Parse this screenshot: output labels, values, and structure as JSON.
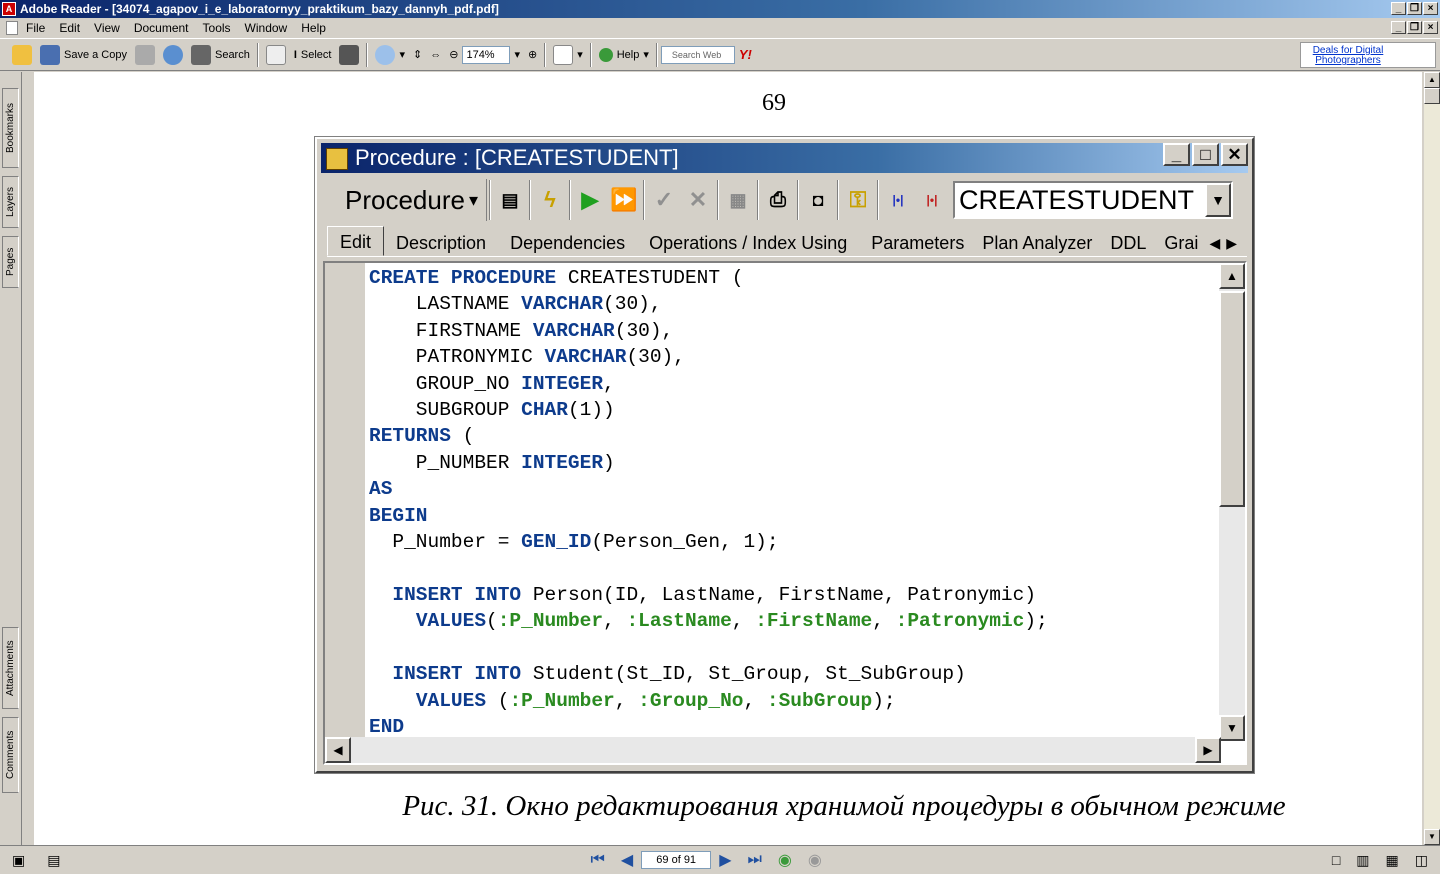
{
  "window": {
    "title": "Adobe Reader - [34074_agapov_i_e_laboratornyy_praktikum_bazy_dannyh_pdf.pdf]"
  },
  "menu": [
    "File",
    "Edit",
    "View",
    "Document",
    "Tools",
    "Window",
    "Help"
  ],
  "toolbar": {
    "save_copy": "Save a Copy",
    "search": "Search",
    "select": "Select",
    "zoom": "174%",
    "help": "Help",
    "search_web_placeholder": "Search Web",
    "yahoo": "Y!"
  },
  "ad": {
    "text": "Deals for Digital Photographers"
  },
  "sidetabs": {
    "bookmarks": "Bookmarks",
    "layers": "Layers",
    "pages": "Pages",
    "attachments": "Attachments",
    "comments": "Comments"
  },
  "page": {
    "number": "69",
    "caption": "Рис. 31. Окно редактирования хранимой процедуры в обычном режиме"
  },
  "dialog": {
    "title": "Procedure : [CREATESTUDENT]",
    "object_type": "Procedure",
    "object_name": "CREATESTUDENT",
    "tabs": [
      "Edit",
      "Description",
      "Dependencies",
      "Operations / Index Using",
      "Parameters",
      "Plan Analyzer",
      "DDL",
      "Grai"
    ],
    "active_tab": "Edit"
  },
  "code_lines": [
    [
      [
        "CREATE PROCEDURE",
        "kw"
      ],
      [
        " CREATESTUDENT (",
        ""
      ]
    ],
    [
      [
        "    LASTNAME ",
        ""
      ],
      [
        "VARCHAR",
        "kw"
      ],
      [
        "(30),",
        ""
      ]
    ],
    [
      [
        "    FIRSTNAME ",
        ""
      ],
      [
        "VARCHAR",
        "kw"
      ],
      [
        "(30),",
        ""
      ]
    ],
    [
      [
        "    PATRONYMIC ",
        ""
      ],
      [
        "VARCHAR",
        "kw"
      ],
      [
        "(30),",
        ""
      ]
    ],
    [
      [
        "    GROUP_NO ",
        ""
      ],
      [
        "INTEGER",
        "kw"
      ],
      [
        ",",
        ""
      ]
    ],
    [
      [
        "    SUBGROUP ",
        ""
      ],
      [
        "CHAR",
        "kw"
      ],
      [
        "(1))",
        ""
      ]
    ],
    [
      [
        "RETURNS",
        "kw"
      ],
      [
        " (",
        ""
      ]
    ],
    [
      [
        "    P_NUMBER ",
        ""
      ],
      [
        "INTEGER",
        "kw"
      ],
      [
        ")",
        ""
      ]
    ],
    [
      [
        "AS",
        "kw"
      ]
    ],
    [
      [
        "BEGIN",
        "kw"
      ]
    ],
    [
      [
        "  P_Number = ",
        ""
      ],
      [
        "GEN_ID",
        "kw"
      ],
      [
        "(Person_Gen, 1);",
        ""
      ]
    ],
    [
      [
        "",
        ""
      ]
    ],
    [
      [
        "  ",
        ""
      ],
      [
        "INSERT INTO",
        "kw"
      ],
      [
        " Person(ID, LastName, FirstName, Patronymic)",
        ""
      ]
    ],
    [
      [
        "    ",
        ""
      ],
      [
        "VALUES",
        "kw"
      ],
      [
        "(",
        ""
      ],
      [
        ":P_Number",
        "pr"
      ],
      [
        ", ",
        ""
      ],
      [
        ":LastName",
        "pr"
      ],
      [
        ", ",
        ""
      ],
      [
        ":FirstName",
        "pr"
      ],
      [
        ", ",
        ""
      ],
      [
        ":Patronymic",
        "pr"
      ],
      [
        ");",
        ""
      ]
    ],
    [
      [
        "",
        ""
      ]
    ],
    [
      [
        "  ",
        ""
      ],
      [
        "INSERT INTO",
        "kw"
      ],
      [
        " Student(St_ID, St_Group, St_SubGroup)",
        ""
      ]
    ],
    [
      [
        "    ",
        ""
      ],
      [
        "VALUES",
        "kw"
      ],
      [
        " (",
        ""
      ],
      [
        ":P_Number",
        "pr"
      ],
      [
        ", ",
        ""
      ],
      [
        ":Group_No",
        "pr"
      ],
      [
        ", ",
        ""
      ],
      [
        ":SubGroup",
        "pr"
      ],
      [
        ");",
        ""
      ]
    ],
    [
      [
        "END",
        "kw"
      ]
    ]
  ],
  "status": {
    "page_field": "69 of 91"
  }
}
